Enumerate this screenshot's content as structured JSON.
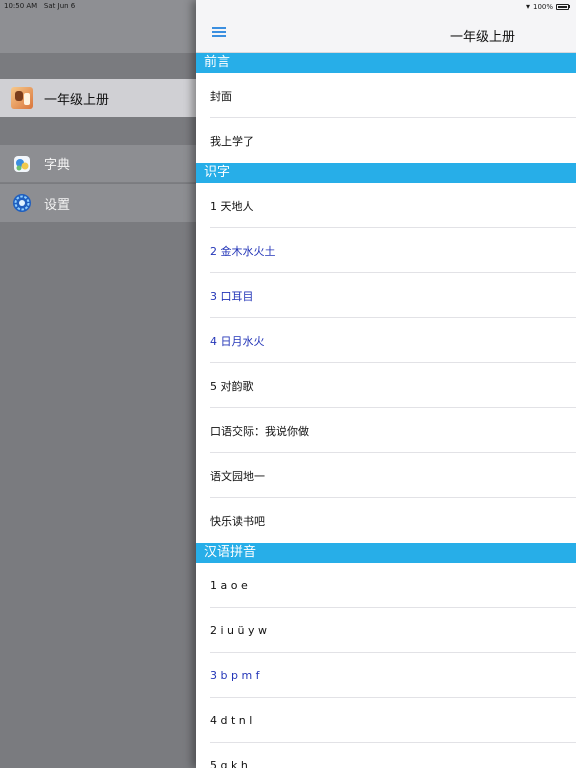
{
  "status": {
    "time": "10:50 AM",
    "date": "Sat Jun 6",
    "battery": "100%"
  },
  "sidebar": {
    "book": "一年级上册",
    "dictionary": "字典",
    "settings": "设置"
  },
  "nav": {
    "title": "一年级上册"
  },
  "sections": [
    {
      "title": "前言",
      "items": [
        {
          "label": "封面",
          "highlight": false
        },
        {
          "label": "我上学了",
          "highlight": false
        }
      ]
    },
    {
      "title": "识字",
      "items": [
        {
          "label": "1 天地人",
          "highlight": false
        },
        {
          "label": "2 金木水火土",
          "highlight": true
        },
        {
          "label": "3 口耳目",
          "highlight": true
        },
        {
          "label": "4 日月水火",
          "highlight": true
        },
        {
          "label": "5 对韵歌",
          "highlight": false
        },
        {
          "label": "口语交际：我说你做",
          "highlight": false
        },
        {
          "label": "语文园地一",
          "highlight": false
        },
        {
          "label": "快乐读书吧",
          "highlight": false
        }
      ]
    },
    {
      "title": "汉语拼音",
      "items": [
        {
          "label": "1 a o e",
          "highlight": false
        },
        {
          "label": "2 i u ü y w",
          "highlight": false
        },
        {
          "label": "3 b p m f",
          "highlight": true
        },
        {
          "label": "4 d t n l",
          "highlight": false
        },
        {
          "label": "5 g k h",
          "highlight": false
        }
      ]
    }
  ]
}
